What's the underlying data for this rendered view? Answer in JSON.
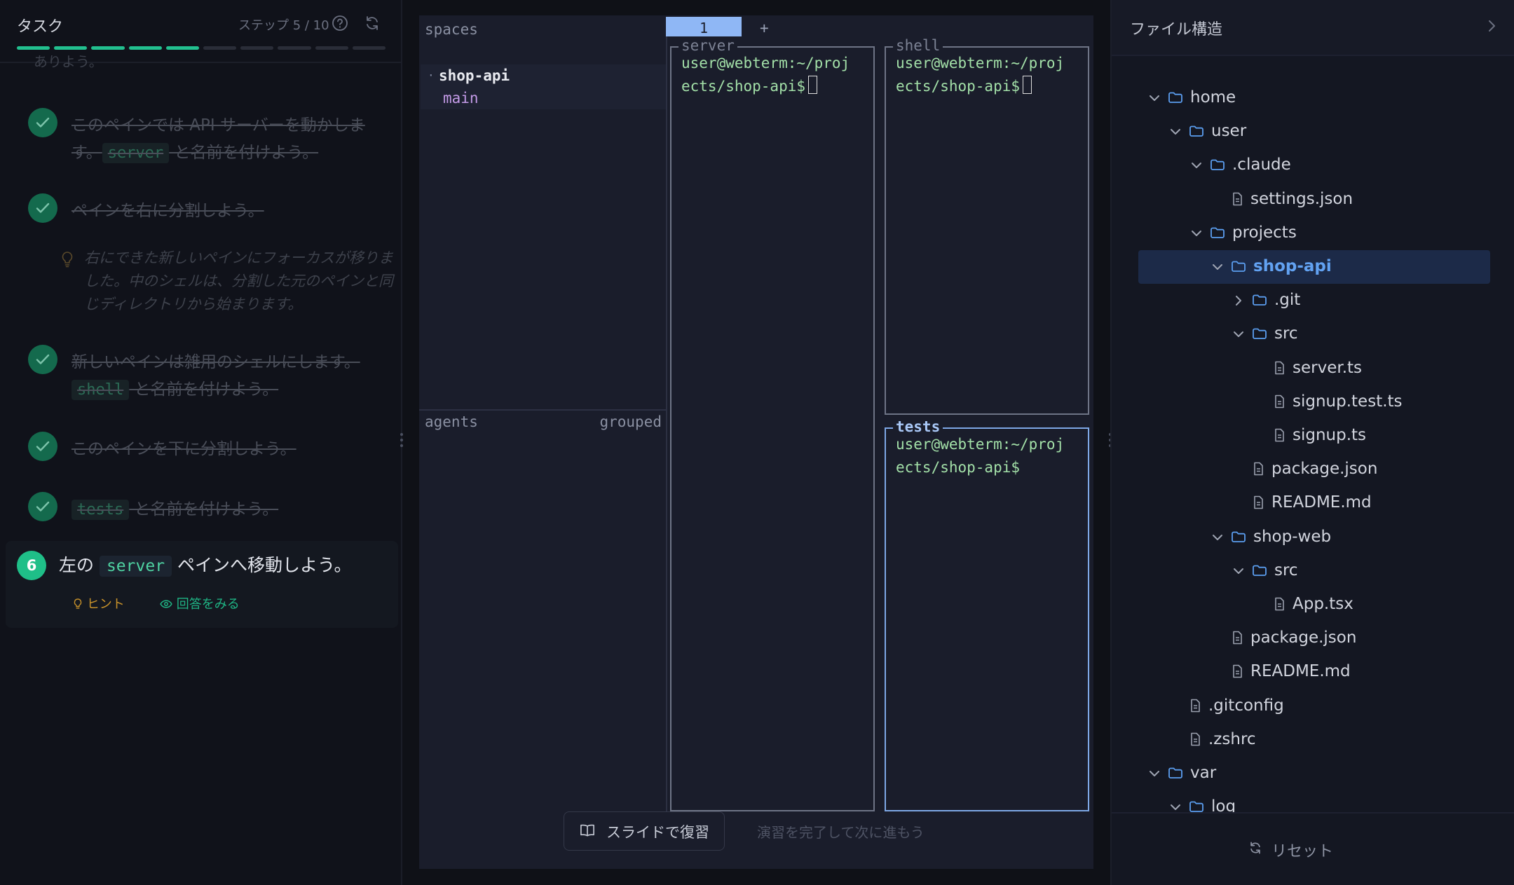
{
  "task_panel": {
    "title": "タスク",
    "step_counter": "ステップ 5 / 10",
    "progress": {
      "done": 5,
      "total": 10
    },
    "clipped_text": "ありよう。",
    "completed_tasks": [
      {
        "before": "このペインでは API サーバーを動かします。",
        "chip": "server",
        "after": " と名前を付けよう。"
      },
      {
        "before": "ペインを右に分割しよう。",
        "chip": "",
        "after": ""
      },
      {
        "before": "新しいペインは雑用のシェルにします。",
        "chip": "shell",
        "after": " と名前を付けよう。"
      },
      {
        "before": "このペインを下に分割しよう。",
        "chip": "",
        "after": ""
      },
      {
        "before": "",
        "chip": "tests",
        "after": " と名前を付けよう。"
      }
    ],
    "hint_text": "右にできた新しいペインにフォーカスが移りました。中のシェルは、分割した元のペインと同じディレクトリから始まります。",
    "current_task": {
      "number": "6",
      "before": "左の ",
      "chip": "server",
      "after": " ペインへ移動しよう。",
      "hint_label": "ヒント",
      "answer_label": "回答をみる"
    }
  },
  "terminal": {
    "sidebar": {
      "spaces_label": "spaces",
      "space_name": "shop-api",
      "space_dot": "·",
      "space_sub": "main",
      "agents_label": "agents",
      "grouped_label": "grouped"
    },
    "window_tab": "1",
    "window_add": "+",
    "panes": [
      {
        "title": "server",
        "line1": "user@webterm:~/proj",
        "line2": "ects/shop-api$"
      },
      {
        "title": "shell",
        "line1": "user@webterm:~/proj",
        "line2": "ects/shop-api$"
      },
      {
        "title": "tests",
        "line1": "user@webterm:~/proj",
        "line2": "ects/shop-api$"
      }
    ],
    "review_button": "スライドで復習",
    "complete_text": "演習を完了して次に進もう"
  },
  "file_tree": {
    "title": "ファイル構造",
    "reset_label": "リセット",
    "items": [
      {
        "name": "home",
        "type": "folder",
        "depth": 0,
        "expanded": true
      },
      {
        "name": "user",
        "type": "folder",
        "depth": 1,
        "expanded": true
      },
      {
        "name": ".claude",
        "type": "folder",
        "depth": 2,
        "expanded": true
      },
      {
        "name": "settings.json",
        "type": "file",
        "depth": 3
      },
      {
        "name": "projects",
        "type": "folder",
        "depth": 2,
        "expanded": true
      },
      {
        "name": "shop-api",
        "type": "folder",
        "depth": 3,
        "expanded": true,
        "selected": true
      },
      {
        "name": ".git",
        "type": "folder",
        "depth": 4,
        "expanded": false
      },
      {
        "name": "src",
        "type": "folder",
        "depth": 4,
        "expanded": true
      },
      {
        "name": "server.ts",
        "type": "file",
        "depth": 5
      },
      {
        "name": "signup.test.ts",
        "type": "file",
        "depth": 5
      },
      {
        "name": "signup.ts",
        "type": "file",
        "depth": 5
      },
      {
        "name": "package.json",
        "type": "file",
        "depth": 4
      },
      {
        "name": "README.md",
        "type": "file",
        "depth": 4
      },
      {
        "name": "shop-web",
        "type": "folder",
        "depth": 3,
        "expanded": true
      },
      {
        "name": "src",
        "type": "folder",
        "depth": 4,
        "expanded": true
      },
      {
        "name": "App.tsx",
        "type": "file",
        "depth": 5
      },
      {
        "name": "package.json",
        "type": "file",
        "depth": 3
      },
      {
        "name": "README.md",
        "type": "file",
        "depth": 3
      },
      {
        "name": ".gitconfig",
        "type": "file",
        "depth": 1
      },
      {
        "name": ".zshrc",
        "type": "file",
        "depth": 1
      },
      {
        "name": "var",
        "type": "folder",
        "depth": 0,
        "expanded": true
      },
      {
        "name": "log",
        "type": "folder",
        "depth": 1,
        "expanded": true
      }
    ]
  },
  "colors": {
    "accent_green": "#22c08f",
    "accent_blue": "#62a2f2",
    "terminal_text": "#a3e0a8",
    "active_tab": "#8fb7f5"
  }
}
